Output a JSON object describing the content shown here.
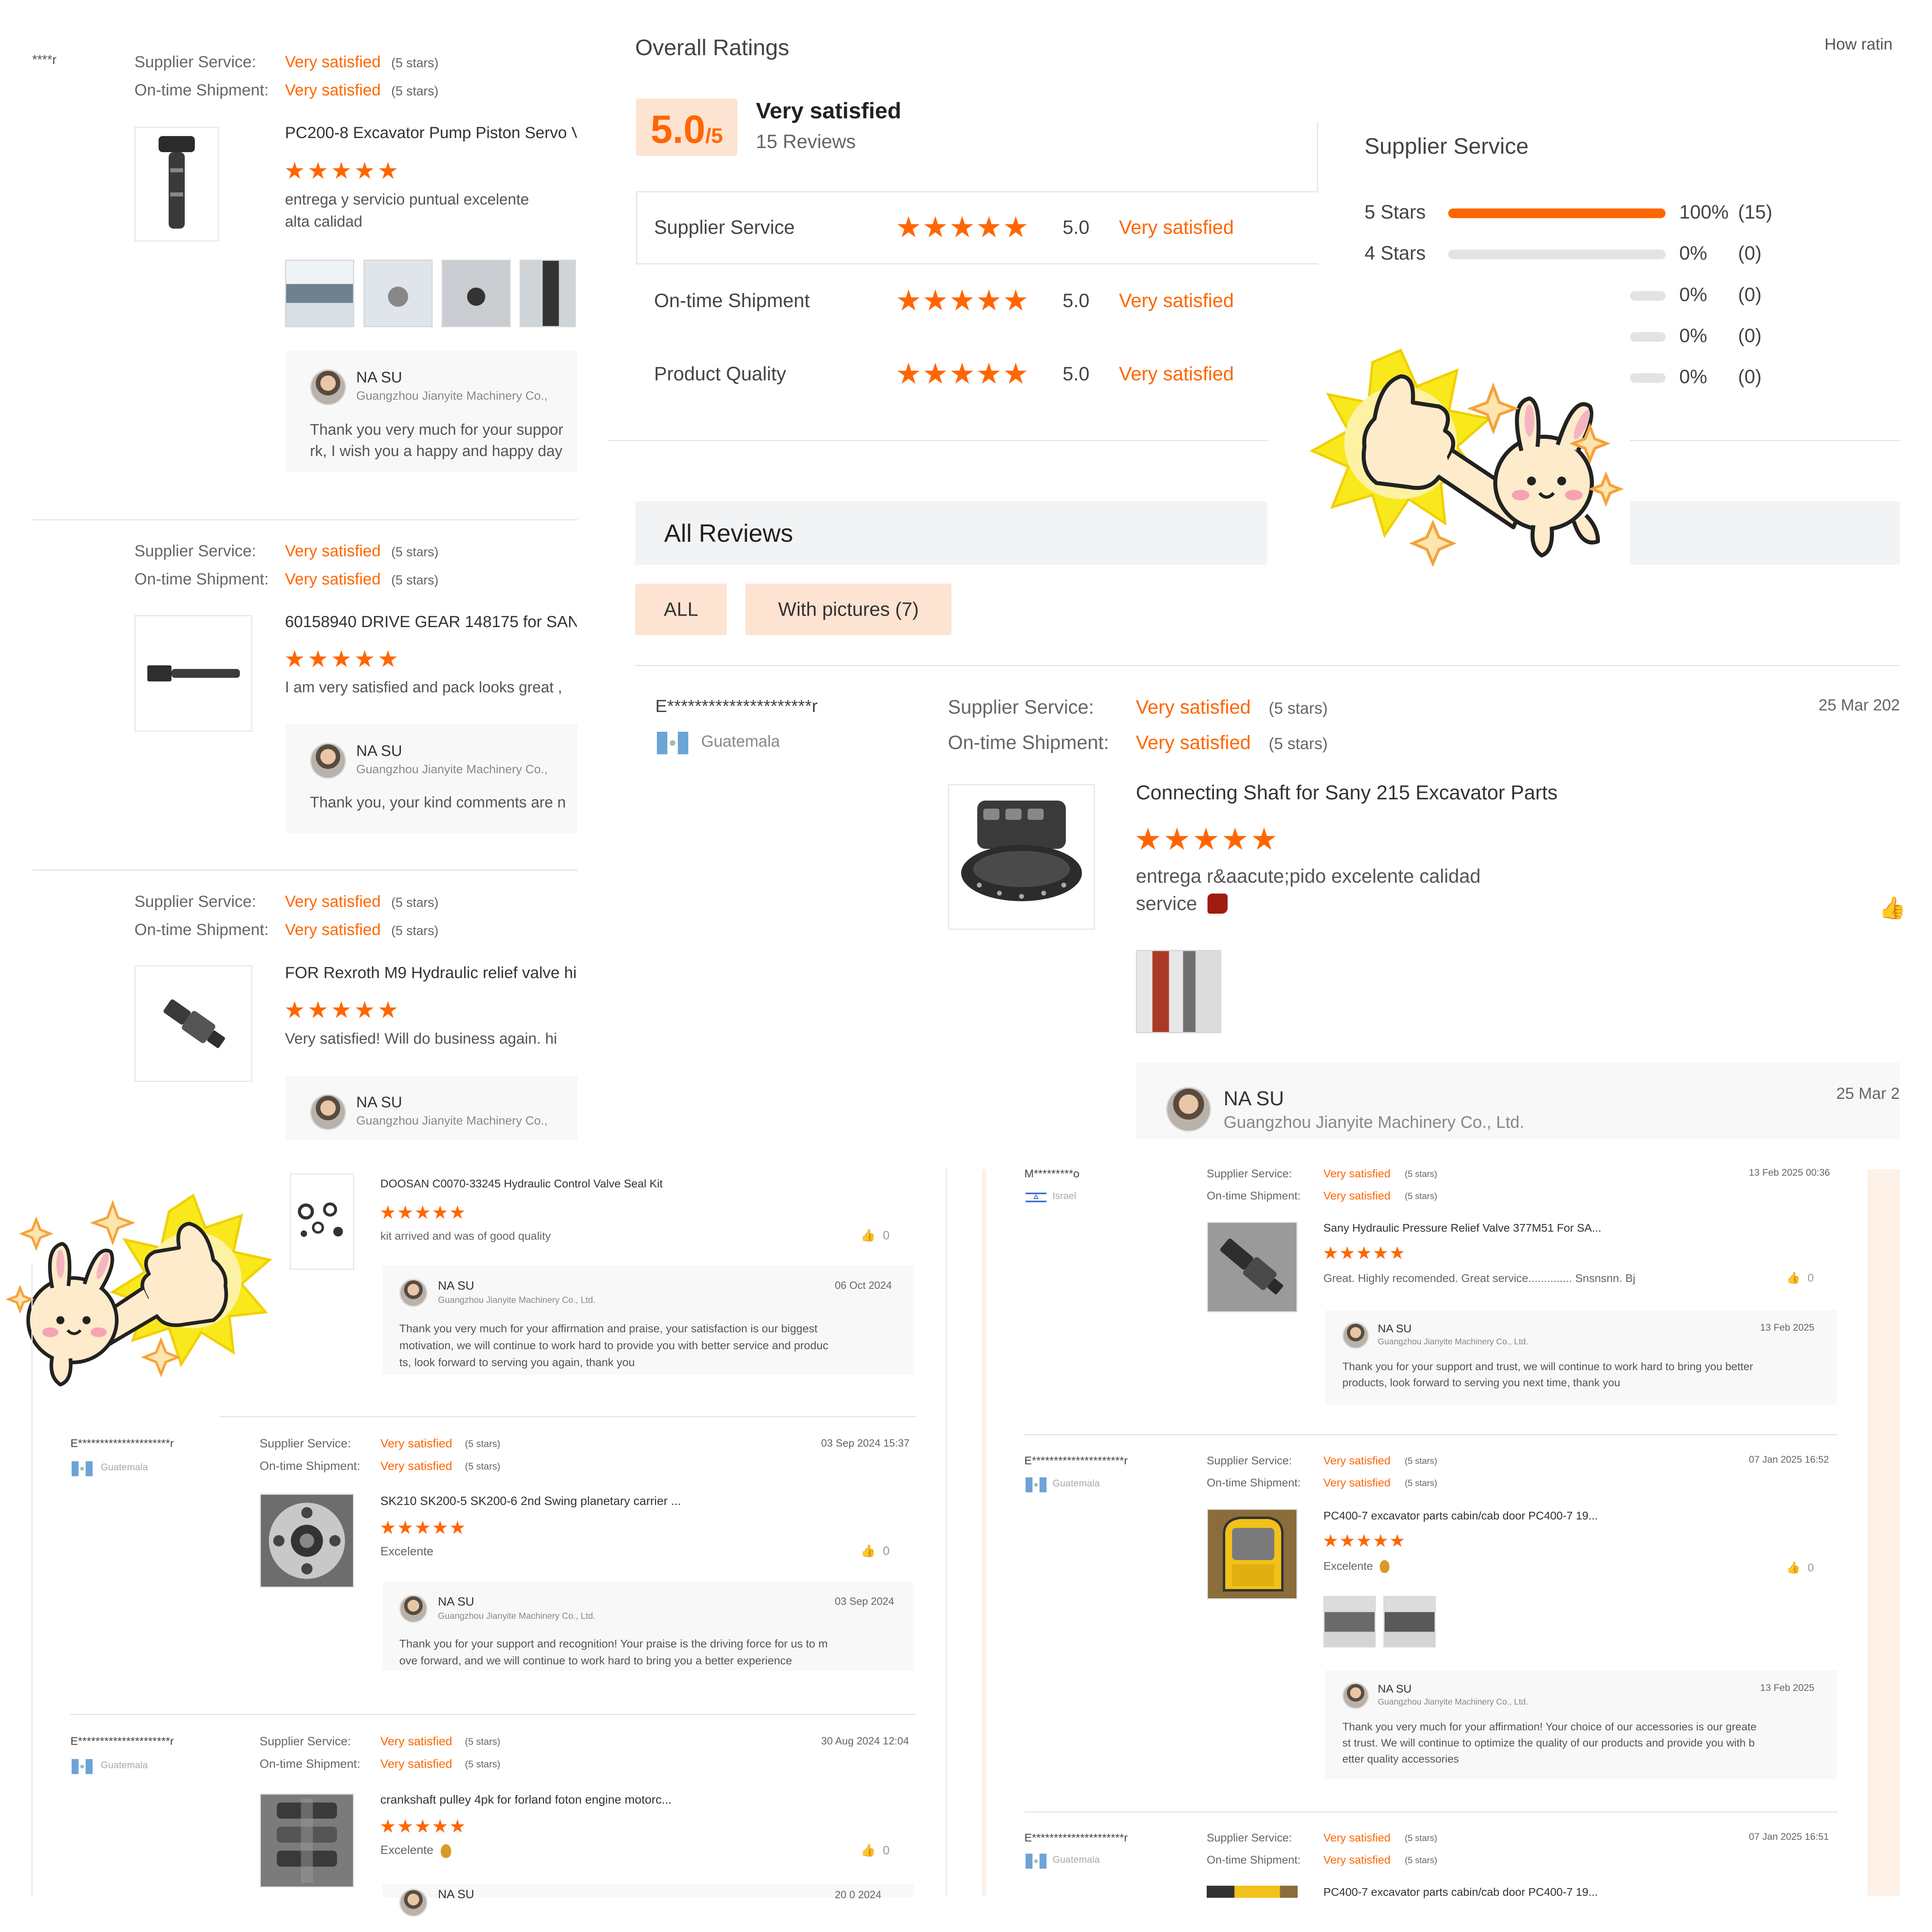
{
  "left_panel": {
    "top_reviewer": "****r",
    "label_supplier": "Supplier Service:",
    "label_shipment": "On-time Shipment:",
    "rating_text": "Very satisfied",
    "rating_count": "(5 stars)",
    "stars": "★★★★★",
    "reviews": [
      {
        "product": "PC200-8 Excavator Pump Piston Servo V",
        "comment": [
          "entrega y servicio puntual excelente",
          "alta calidad"
        ],
        "reply_name": "NA SU",
        "reply_company": "Guangzhou Jianyite Machinery Co.,",
        "reply_text": [
          "Thank you very much for your suppor",
          "rk, I wish you a happy and happy day"
        ]
      },
      {
        "product": "60158940 DRIVE GEAR 148175 for SANY",
        "comment": [
          "I am very satisfied and pack looks great ,"
        ],
        "reply_name": "NA SU",
        "reply_company": "Guangzhou Jianyite Machinery Co.,",
        "reply_text": [
          "Thank you, your kind comments are n"
        ]
      },
      {
        "product": "FOR Rexroth M9 Hydraulic relief valve hi",
        "comment": [
          "Very satisfied! Will do business again. hi"
        ],
        "reply_name": "NA SU",
        "reply_company": "Guangzhou Jianyite Machinery Co.,"
      }
    ]
  },
  "overall": {
    "title": "Overall Ratings",
    "score": "5.0",
    "score_suffix": "/5",
    "score_label": "Very satisfied",
    "review_count": "15 Reviews",
    "rows": [
      {
        "label": "Supplier Service",
        "value": "5.0",
        "text": "Very satisfied"
      },
      {
        "label": "On-time Shipment",
        "value": "5.0",
        "text": "Very satisfied"
      },
      {
        "label": "Product Quality",
        "value": "5.0",
        "text": "Very satisfied"
      }
    ],
    "how_rating": "How ratin"
  },
  "breakdown": {
    "title": "Supplier Service",
    "rows": [
      {
        "label": "5  Stars",
        "pct": "100%",
        "count": "(15)",
        "fill": 1.0
      },
      {
        "label": "4  Stars",
        "pct": "0%",
        "count": "(0)",
        "fill": 0
      },
      {
        "label": "",
        "pct": "0%",
        "count": "(0)",
        "fill": 0
      },
      {
        "label": "",
        "pct": "0%",
        "count": "(0)",
        "fill": 0
      },
      {
        "label": "",
        "pct": "0%",
        "count": "(0)",
        "fill": 0
      }
    ]
  },
  "all_reviews": {
    "title": "All Reviews",
    "filter_all": "ALL",
    "filter_pictures": "With pictures (7)",
    "first": {
      "reviewer": "E*********************r",
      "country": "Guatemala",
      "supplier_label": "Supplier Service:",
      "shipment_label": "On-time Shipment:",
      "rating_text": "Very satisfied",
      "rating_count": "(5 stars)",
      "date": "25 Mar 202",
      "product": "Connecting Shaft for Sany 215 Excavator Parts",
      "comment": [
        "entrega r&aacute;pido excelente calidad",
        "service"
      ],
      "reply_name": "NA SU",
      "reply_company": "Guangzhou Jianyite Machinery Co., Ltd.",
      "reply_date": "25 Mar 2"
    }
  },
  "bottom_left": {
    "stars": "★★★★★",
    "supplier_label": "Supplier Service:",
    "shipment_label": "On-time Shipment:",
    "rating_text": "Very satisfied",
    "rating_count": "(5 stars)",
    "like_count": "0",
    "top": {
      "product": "DOOSAN C0070-33245 Hydraulic Control Valve Seal Kit",
      "comment": "kit arrived and was of good quality",
      "reply_name": "NA SU",
      "reply_company": "Guangzhou Jianyite Machinery Co., Ltd.",
      "reply_date": "06 Oct 2024",
      "reply_text": [
        "Thank you very much for your affirmation and praise, your satisfaction is our biggest",
        "motivation, we will continue to work hard to provide you with better service and produc",
        "ts, look forward to serving you again, thank you"
      ]
    },
    "second": {
      "reviewer": "E*********************r",
      "country": "Guatemala",
      "date": "03 Sep 2024 15:37",
      "product": "SK210 SK200-5 SK200-6 2nd Swing planetary carrier ...",
      "comment": "Excelente",
      "reply_name": "NA SU",
      "reply_company": "Guangzhou Jianyite Machinery Co., Ltd.",
      "reply_date": "03 Sep 2024",
      "reply_text": [
        "Thank you for your support and recognition! Your praise is the driving force for us to m",
        "ove forward, and we will continue to work hard to bring you a better experience"
      ]
    },
    "third": {
      "reviewer": "E*********************r",
      "country": "Guatemala",
      "date": "30 Aug 2024 12:04",
      "product": "crankshaft pulley 4pk for forland foton engine motorc...",
      "comment": "Excelente",
      "reply_name": "NA SU",
      "reply_date": "20 0  2024"
    }
  },
  "bottom_right": {
    "stars": "★★★★★",
    "supplier_label": "Supplier Service:",
    "shipment_label": "On-time Shipment:",
    "rating_text": "Very satisfied",
    "rating_count": "(5 stars)",
    "like_count": "0",
    "first": {
      "reviewer": "M*********o",
      "country": "Israel",
      "date": "13 Feb 2025 00:36",
      "product": "Sany Hydraulic Pressure Relief Valve 377M51 For SA...",
      "comment": "Great. Highly recomended. Great service.............. Snsnsnn. Bj",
      "reply_name": "NA SU",
      "reply_company": "Guangzhou Jianyite Machinery Co., Ltd.",
      "reply_date": "13 Feb 2025",
      "reply_text": [
        "Thank you for your support and trust, we will continue to work hard to bring you better",
        "products, look forward to serving you next time, thank you"
      ]
    },
    "second": {
      "reviewer": "E*********************r",
      "country": "Guatemala",
      "date": "07 Jan 2025 16:52",
      "product": "PC400-7 excavator parts cabin/cab door PC400-7 19...",
      "comment": "Excelente",
      "reply_name": "NA SU",
      "reply_company": "Guangzhou Jianyite Machinery Co., Ltd.",
      "reply_date": "13 Feb 2025",
      "reply_text": [
        "Thank you very much for your affirmation! Your choice of our accessories is our greate",
        "st trust. We will continue to optimize the quality of our products and provide you with b",
        "etter quality accessories"
      ]
    },
    "third": {
      "reviewer": "E*********************r",
      "country": "Guatemala",
      "date": "07 Jan 2025 16:51",
      "product": "PC400-7 excavator parts cabin/cab door PC400-7 19..."
    }
  },
  "colors": {
    "accent": "#ff6600",
    "accent_light": "#fde3d1",
    "bar_bg": "#e3e3e3",
    "sticker_yellow": "#f8e81c"
  }
}
